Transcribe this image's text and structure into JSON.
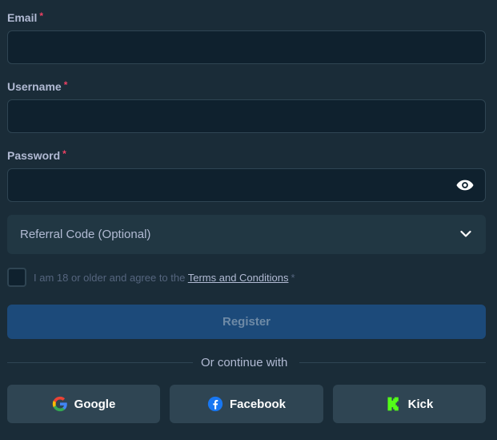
{
  "form": {
    "email": {
      "label": "Email",
      "required_mark": "*",
      "value": ""
    },
    "username": {
      "label": "Username",
      "required_mark": "*",
      "value": ""
    },
    "password": {
      "label": "Password",
      "required_mark": "*",
      "value": "",
      "toggle_icon": "eye-icon"
    },
    "referral": {
      "label": "Referral Code (Optional)",
      "icon": "chevron-down-icon"
    },
    "agree": {
      "checked": false,
      "text": "I am 18 or older and agree to the ",
      "link": "Terms and Conditions",
      "required_mark": "*"
    },
    "register_label": "Register",
    "divider_text": "Or continue with",
    "social": [
      {
        "label": "Google",
        "icon": "google-icon"
      },
      {
        "label": "Facebook",
        "icon": "facebook-icon"
      },
      {
        "label": "Kick",
        "icon": "kick-icon"
      }
    ]
  },
  "colors": {
    "background": "#1a2c38",
    "input_bg": "#0f212e",
    "border": "#2f4553",
    "button_primary": "#1c4a7a",
    "required": "#ed4163",
    "kick_green": "#53fc18",
    "facebook_blue": "#1877f2"
  }
}
